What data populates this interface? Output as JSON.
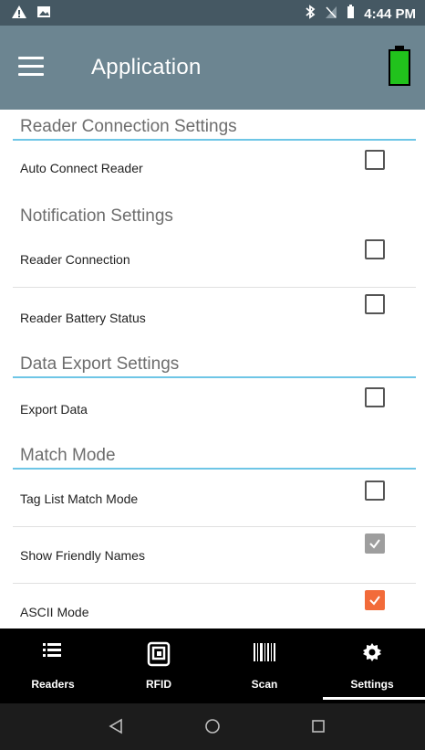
{
  "status_bar": {
    "time": "4:44 PM"
  },
  "app_bar": {
    "title": "Application"
  },
  "sections": {
    "reader_connection": {
      "header": "Reader Connection Settings",
      "auto_connect": "Auto Connect Reader"
    },
    "notification": {
      "header": "Notification Settings",
      "reader_connection": "Reader Connection",
      "battery_status": "Reader Battery Status"
    },
    "data_export": {
      "header": "Data Export Settings",
      "export_data": "Export Data"
    },
    "match_mode": {
      "header": "Match Mode",
      "tag_list": "Tag List Match Mode",
      "friendly_names": "Show Friendly Names",
      "ascii": "ASCII Mode"
    }
  },
  "checkbox_states": {
    "auto_connect": false,
    "reader_connection": false,
    "battery_status": false,
    "export_data": false,
    "tag_list": false,
    "friendly_names": true,
    "ascii": true
  },
  "colors": {
    "appbar": "#6c8591",
    "statusbar": "#455863",
    "accent_line": "#6ec6e6",
    "checked_orange": "#f26b3a",
    "battery": "#21c21c"
  },
  "bottom_nav": {
    "readers": "Readers",
    "rfid": "RFID",
    "scan": "Scan",
    "settings": "Settings",
    "active": "settings"
  }
}
